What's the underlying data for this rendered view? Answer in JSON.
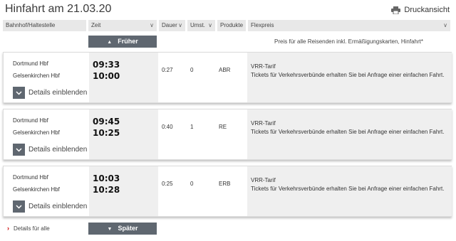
{
  "page": {
    "title": "Hinfahrt am 21.03.20",
    "print_label": "Druckansicht"
  },
  "columns": [
    {
      "label": "Bahnhof/Haltestelle"
    },
    {
      "label": "Zeit"
    },
    {
      "label": "Dauer"
    },
    {
      "label": "Umst."
    },
    {
      "label": "Produkte"
    },
    {
      "label": "Flexpreis"
    }
  ],
  "earlier_label": "Früher",
  "later_label": "Später",
  "price_note": "Preis für alle Reisenden inkl. Ermäßigungskarten, Hinfahrt*",
  "details_label": "Details einblenden",
  "details_all_label": "Details für alle",
  "connections": [
    {
      "from": "Dortmund Hbf",
      "to": "Gelsenkirchen Hbf",
      "dep": "09:33",
      "arr": "10:00",
      "duration": "0:27",
      "changes": "0",
      "product": "ABR",
      "tariff": "VRR-Tarif",
      "tariff_text": "Tickets für Verkehrsverbünde erhalten Sie bei Anfrage einer einfachen Fahrt."
    },
    {
      "from": "Dortmund Hbf",
      "to": "Gelsenkirchen Hbf",
      "dep": "09:45",
      "arr": "10:25",
      "duration": "0:40",
      "changes": "1",
      "product": "RE",
      "tariff": "VRR-Tarif",
      "tariff_text": "Tickets für Verkehrsverbünde erhalten Sie bei Anfrage einer einfachen Fahrt."
    },
    {
      "from": "Dortmund Hbf",
      "to": "Gelsenkirchen Hbf",
      "dep": "10:03",
      "arr": "10:28",
      "duration": "0:25",
      "changes": "0",
      "product": "ERB",
      "tariff": "VRR-Tarif",
      "tariff_text": "Tickets für Verkehrsverbünde erhalten Sie bei Anfrage einer einfachen Fahrt."
    }
  ],
  "colors": {
    "button": "#5f6770",
    "header": "#e8e8e8",
    "accent": "#cc0000"
  }
}
